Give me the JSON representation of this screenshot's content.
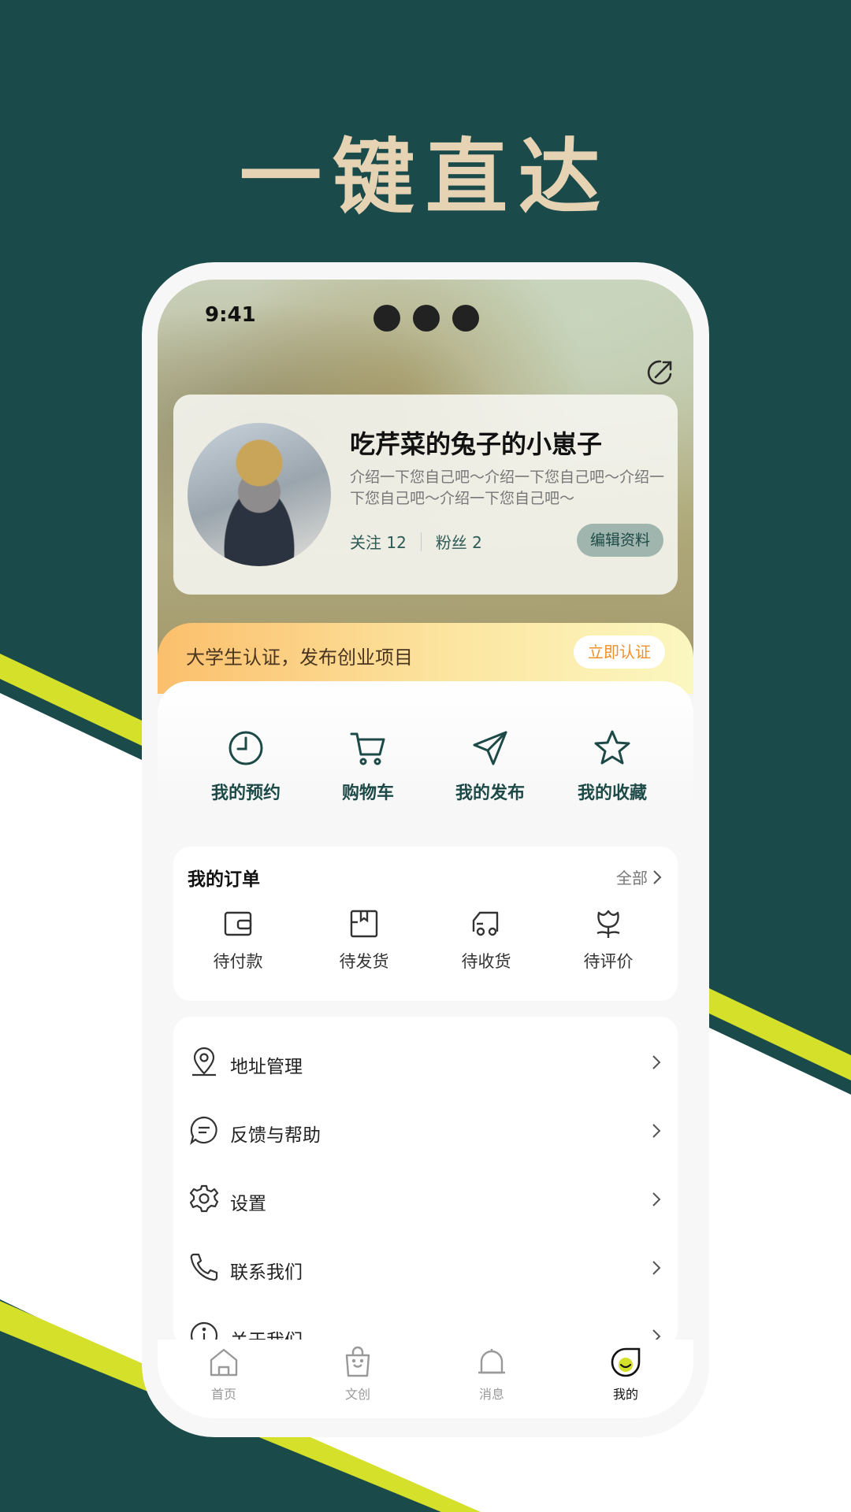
{
  "headline": "一键直达",
  "status_bar": {
    "time": "9:41"
  },
  "profile": {
    "username": "吃芹菜的兔子的小崽子",
    "bio": "介绍一下您自己吧～介绍一下您自己吧～介绍一下您自己吧～介绍一下您自己吧～",
    "following_label": "关注",
    "following_count": "12",
    "followers_label": "粉丝",
    "followers_count": "2",
    "edit_label": "编辑资料"
  },
  "certification": {
    "text": "大学生认证，发布创业项目",
    "button": "立即认证"
  },
  "quick_actions": [
    {
      "label": "我的预约",
      "icon": "clock-icon"
    },
    {
      "label": "购物车",
      "icon": "cart-icon"
    },
    {
      "label": "我的发布",
      "icon": "send-icon"
    },
    {
      "label": "我的收藏",
      "icon": "star-icon"
    }
  ],
  "orders": {
    "title": "我的订单",
    "all_label": "全部",
    "items": [
      {
        "label": "待付款",
        "icon": "wallet-icon"
      },
      {
        "label": "待发货",
        "icon": "box-icon"
      },
      {
        "label": "待收货",
        "icon": "truck-icon"
      },
      {
        "label": "待评价",
        "icon": "flower-icon"
      }
    ]
  },
  "menu": [
    {
      "label": "地址管理",
      "icon": "location-icon"
    },
    {
      "label": "反馈与帮助",
      "icon": "chat-icon"
    },
    {
      "label": "设置",
      "icon": "gear-icon"
    },
    {
      "label": "联系我们",
      "icon": "phone-icon"
    },
    {
      "label": "关于我们",
      "icon": "info-icon"
    }
  ],
  "tabbar": [
    {
      "label": "首页",
      "icon": "home-icon"
    },
    {
      "label": "文创",
      "icon": "bag-icon"
    },
    {
      "label": "消息",
      "icon": "bell-icon"
    },
    {
      "label": "我的",
      "icon": "profile-icon",
      "active": true
    }
  ],
  "colors": {
    "background": "#1a4a4a",
    "accent_stripe": "#d4e02a",
    "headline": "#e6d3b4",
    "primary_text": "#1d4a47",
    "cert_button_text": "#f0902a"
  }
}
